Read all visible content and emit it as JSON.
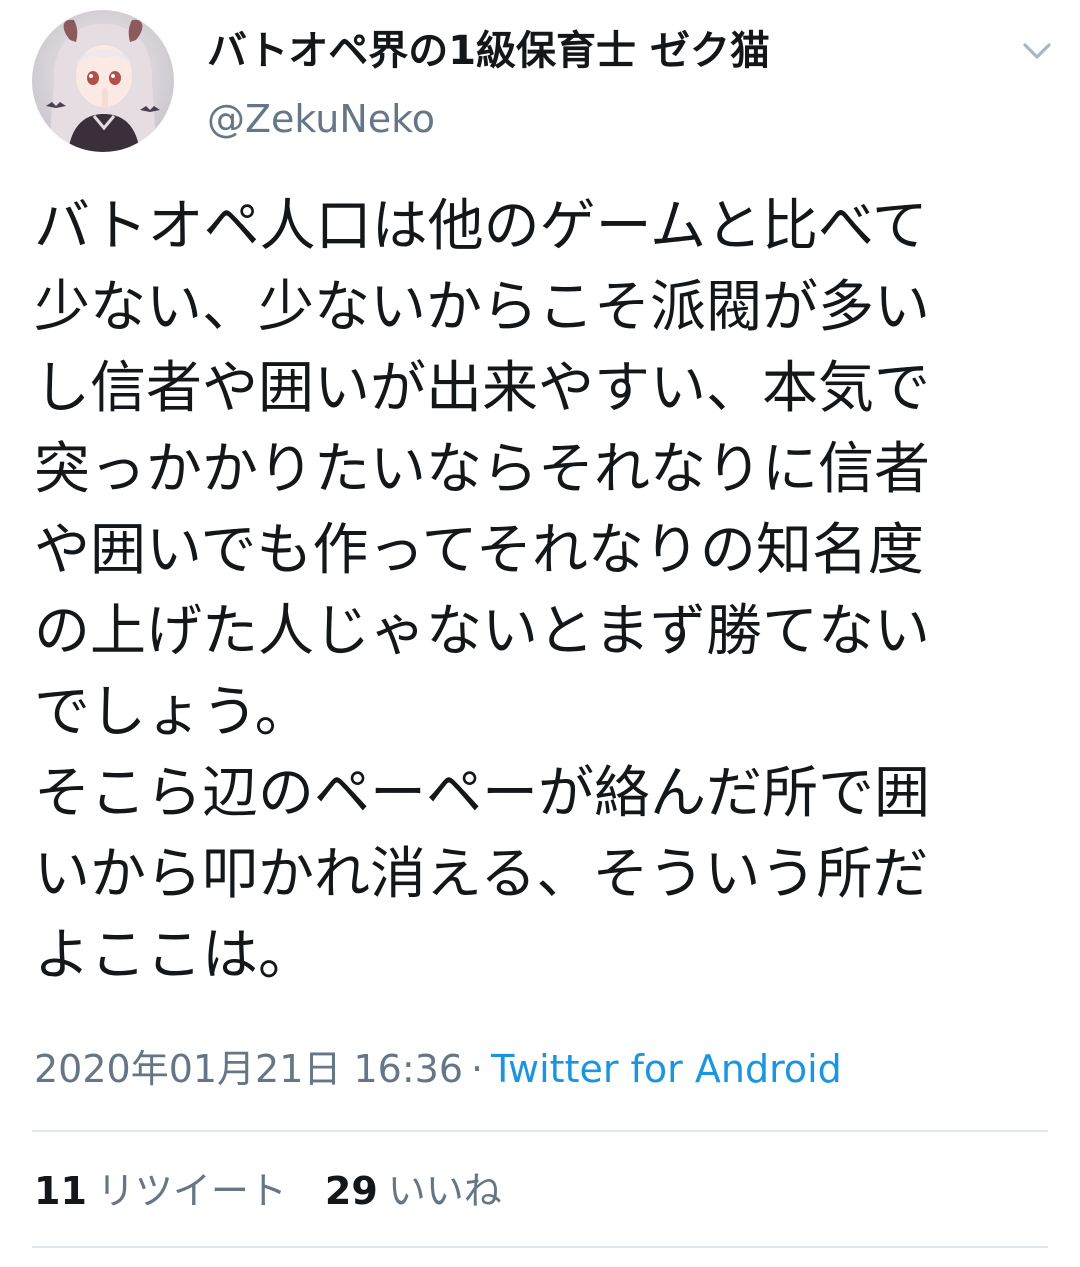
{
  "user": {
    "display_name": "バトオペ界の1級保育士 ゼク猫",
    "handle": "@ZekuNeko",
    "avatar_icon": "profile-avatar-icon"
  },
  "menu_icon": "chevron-down-icon",
  "tweet": {
    "text": "バトオペ人口は他のゲームと比べて\n少ない、少ないからこそ派閥が多い\nし信者や囲いが出来やすい、本気で\n突っかかりたいならそれなりに信者\nや囲いでも作ってそれなりの知名度\nの上げた人じゃないとまず勝てない\nでしょう。\nそこら辺のペーペーが絡んだ所で囲\nいから叩かれ消える、そういう所だ\nよここは。"
  },
  "meta": {
    "timestamp": "2020年01月21日 16:36",
    "separator": "·",
    "source": "Twitter for Android"
  },
  "stats": {
    "retweets_count": "11",
    "retweets_label": "リツイート",
    "likes_count": "29",
    "likes_label": "いいね"
  },
  "colors": {
    "text": "#14171a",
    "secondary": "#657786",
    "link": "#1b95e0",
    "divider": "#e1e8ed"
  }
}
